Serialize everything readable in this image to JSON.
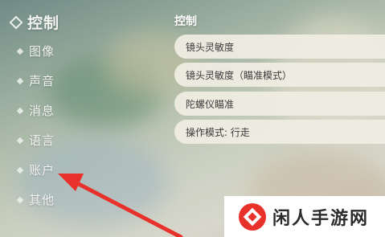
{
  "sidebar": {
    "items": [
      {
        "label": "控制",
        "active": true
      },
      {
        "label": "图像"
      },
      {
        "label": "声音"
      },
      {
        "label": "消息"
      },
      {
        "label": "语言"
      },
      {
        "label": "账户"
      },
      {
        "label": "其他"
      }
    ]
  },
  "main": {
    "section_title": "控制",
    "settings": [
      {
        "label": "镜头灵敏度"
      },
      {
        "label": "镜头灵敏度（瞄准模式）"
      },
      {
        "label": "陀螺仪瞄准"
      },
      {
        "label": "操作模式: 行走"
      }
    ]
  },
  "annotation": {
    "arrow_color": "#e8312b",
    "points_to": "账户"
  },
  "watermark": {
    "text": "闲人手游网"
  }
}
